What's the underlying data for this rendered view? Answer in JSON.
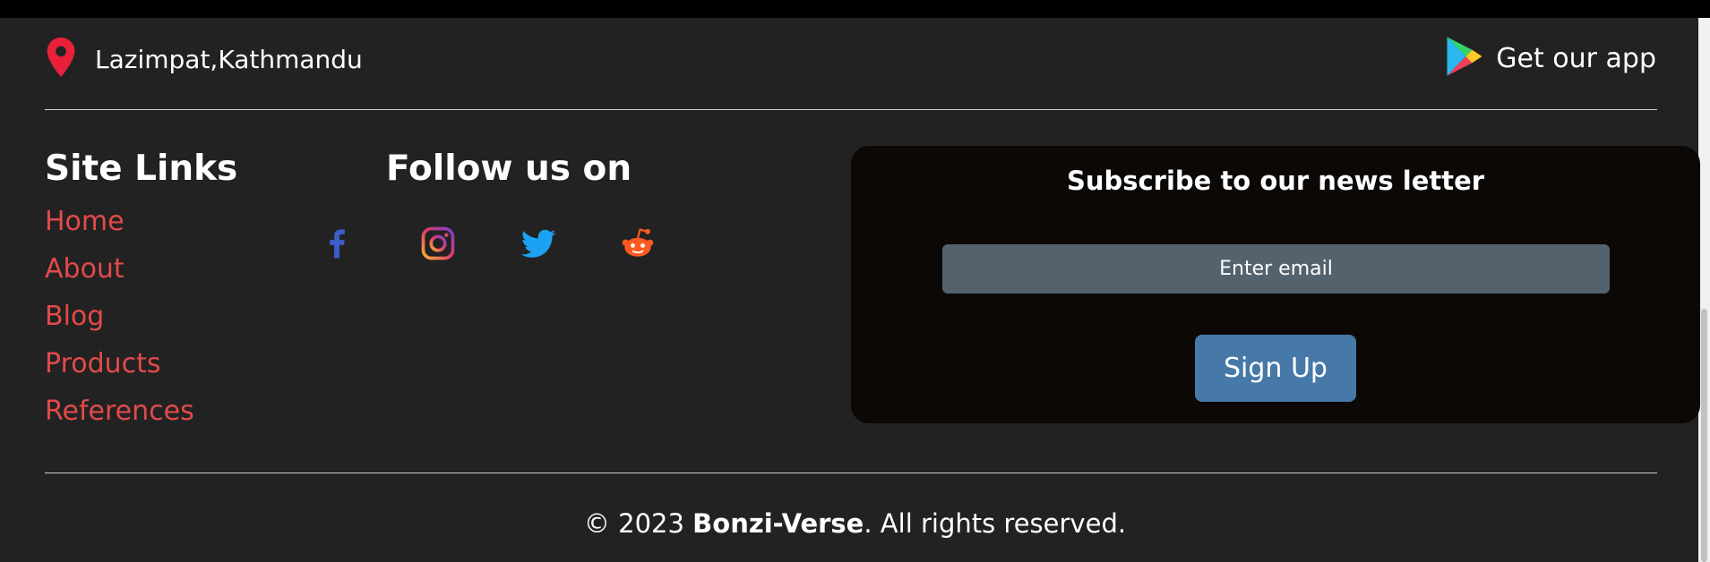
{
  "location": {
    "icon": "map-pin-icon",
    "text": "Lazimpat,Kathmandu"
  },
  "app": {
    "icon": "google-play-icon",
    "text": "Get our app"
  },
  "site_links": {
    "heading": "Site Links",
    "items": [
      {
        "label": "Home"
      },
      {
        "label": "About"
      },
      {
        "label": "Blog"
      },
      {
        "label": "Products"
      },
      {
        "label": "References"
      }
    ]
  },
  "follow": {
    "heading": "Follow us on",
    "icons": [
      "facebook-icon",
      "instagram-icon",
      "twitter-icon",
      "reddit-icon"
    ]
  },
  "newsletter": {
    "title": "Subscribe to our news letter",
    "email_placeholder": "Enter email",
    "button_label": "Sign Up"
  },
  "footer": {
    "prefix": "© 2023 ",
    "brand": "Bonzi-Verse",
    "suffix": ". All rights reserved."
  },
  "colors": {
    "background": "#222222",
    "link": "#e34a4a",
    "newsletter_panel": "#0b0806",
    "input": "#54626e",
    "button": "#4679a8",
    "pin": "#e8203a"
  }
}
